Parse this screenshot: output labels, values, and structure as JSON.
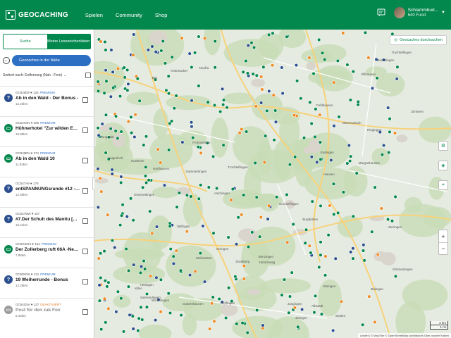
{
  "header": {
    "logo_text": "GEOCACHING",
    "nav": [
      "Spielen",
      "Community",
      "Shop"
    ],
    "user_name": "Schlammbud...",
    "user_finds": "640 Fund"
  },
  "sidebar": {
    "tab_search": "Suche",
    "tab_lists": "Meine Lesezeichenlisten",
    "nearby": "Geocaches in der Nähe",
    "sort_label": "Sortiert nach: Entfernung (Nah - Fern)",
    "items": [
      {
        "icon": "mystery",
        "code": "GC8J8D8",
        "fav": "125",
        "flag": "PREMIUM",
        "name": "Ab in den Wald - Der Bonus -",
        "dist": "12.26km"
      },
      {
        "icon": "traditional",
        "code": "GC5JN1N",
        "fav": "280",
        "flag": "PREMIUM",
        "name": "Hühnerhotel \"Zur wilden Ente\"",
        "dist": "10.88km"
      },
      {
        "icon": "traditional",
        "code": "GC8J8EN",
        "fav": "274",
        "flag": "PREMIUM",
        "name": "Ab in den Wald 10",
        "dist": "11.92km"
      },
      {
        "icon": "mystery",
        "code": "GC547A9",
        "fav": "179",
        "flag": "",
        "name": "entSPANNUNGsrunde #12 -- DE...",
        "dist": "12.06km"
      },
      {
        "icon": "mystery",
        "code": "GC547BW",
        "fav": "167",
        "flag": "",
        "name": "#7.Der Schuh des Manitu [Der S...",
        "dist": "15.41km"
      },
      {
        "icon": "traditional",
        "code": "GC5GDG3",
        "fav": "164",
        "flag": "PREMIUM",
        "name": "Der Zollerberg ruft 06A -Neuer ...",
        "dist": "7.88km"
      },
      {
        "icon": "mystery",
        "code": "GC5D9X6",
        "fav": "131",
        "flag": "PREMIUM",
        "name": "19 Weiherrunde - Bonus",
        "dist": "12.26km"
      },
      {
        "icon": "disabled",
        "code": "GC54G5A",
        "fav": "127",
        "flag": "DEAKTIVIERT",
        "name": "Post für den zak Fox",
        "dist": "8.43km"
      }
    ]
  },
  "map": {
    "browse_label": "Geocaches durchsuchen",
    "scale_km": "2 km",
    "scale_mi": "1 mi",
    "attribution": "Leaflet | © MapTiler © OpenStreetMap contributors  Über unsere Karten",
    "places": [
      "Hechingen",
      "Bisingen",
      "Grosselfingen",
      "Haigerloch",
      "Zimmern",
      "Trochtelfingen",
      "Burladingen",
      "Gammertingen",
      "Albstadt",
      "Meßstetten",
      "Balingen",
      "Hausen",
      "Jungingen",
      "Hettingen",
      "Ringingen",
      "Killer",
      "Veringen",
      "Straßberg",
      "Winterlingen",
      "Dürmentingen",
      "Obereschach",
      "Hartheim",
      "Harthausen",
      "Kettenacker",
      "Tailfingen",
      "Pfeffingen",
      "Onstmettingen",
      "Truchtelfingen",
      "Meringen",
      "Stetten",
      "Hörschwag",
      "Salmendingen",
      "Benzingen",
      "Frohnstetten",
      "Neufra",
      "Feldhausen",
      "Ebingen",
      "Margrethausen",
      "Burgfelden",
      "Zillhausen",
      "Engstlatt",
      "Endingen",
      "Dotternhausen",
      "Bitz"
    ],
    "colors": {
      "green": "#02874d",
      "blue": "#2a4e8f",
      "orange": "#f08a24"
    }
  }
}
